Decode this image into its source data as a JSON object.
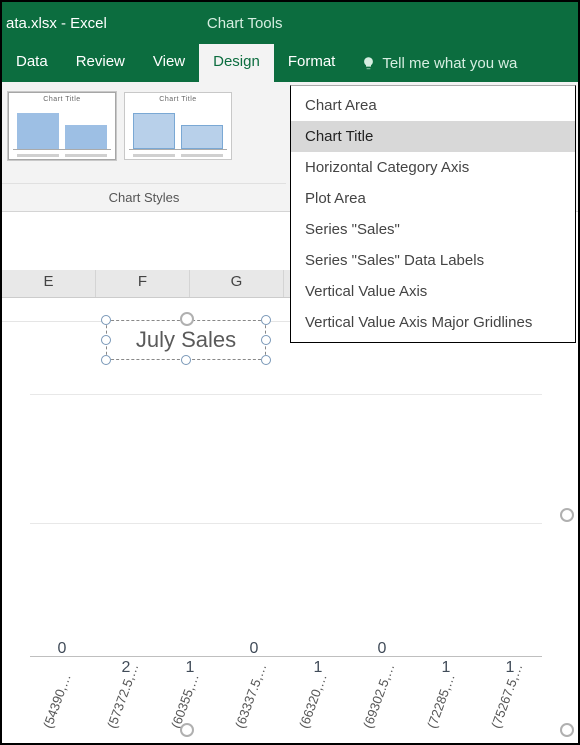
{
  "window": {
    "title": "ata.xlsx - Excel",
    "chart_tools_label": "Chart Tools"
  },
  "ribbon": {
    "tabs": [
      "Data",
      "Review",
      "View",
      "Design",
      "Format"
    ],
    "active_tab": "Design",
    "tell_me_placeholder": "Tell me what you wa",
    "group_label": "Chart Styles",
    "thumb_title1": "Chart Title",
    "thumb_title2": "Chart Title"
  },
  "dropdown": {
    "items": [
      "Chart Area",
      "Chart Title",
      "Horizontal Category Axis",
      "Plot Area",
      "Series \"Sales\"",
      "Series \"Sales\" Data Labels",
      "Vertical Value Axis",
      "Vertical Value Axis Major Gridlines"
    ],
    "highlighted_index": 1
  },
  "sheet": {
    "visible_columns": [
      "E",
      "F",
      "G"
    ]
  },
  "chart": {
    "title": "July Sales"
  },
  "chart_data": {
    "type": "bar",
    "title": "July Sales",
    "categories": [
      "(54390,…",
      "(57372.5,…",
      "(60355,…",
      "(63337.5,…",
      "(66320,…",
      "(69302.5,…",
      "(72285,…",
      "(75267.5,…"
    ],
    "values": [
      0,
      2,
      1,
      0,
      1,
      0,
      1,
      1
    ],
    "series_name": "Sales",
    "ylim": [
      0,
      2
    ],
    "xlabel": "",
    "ylabel": ""
  }
}
